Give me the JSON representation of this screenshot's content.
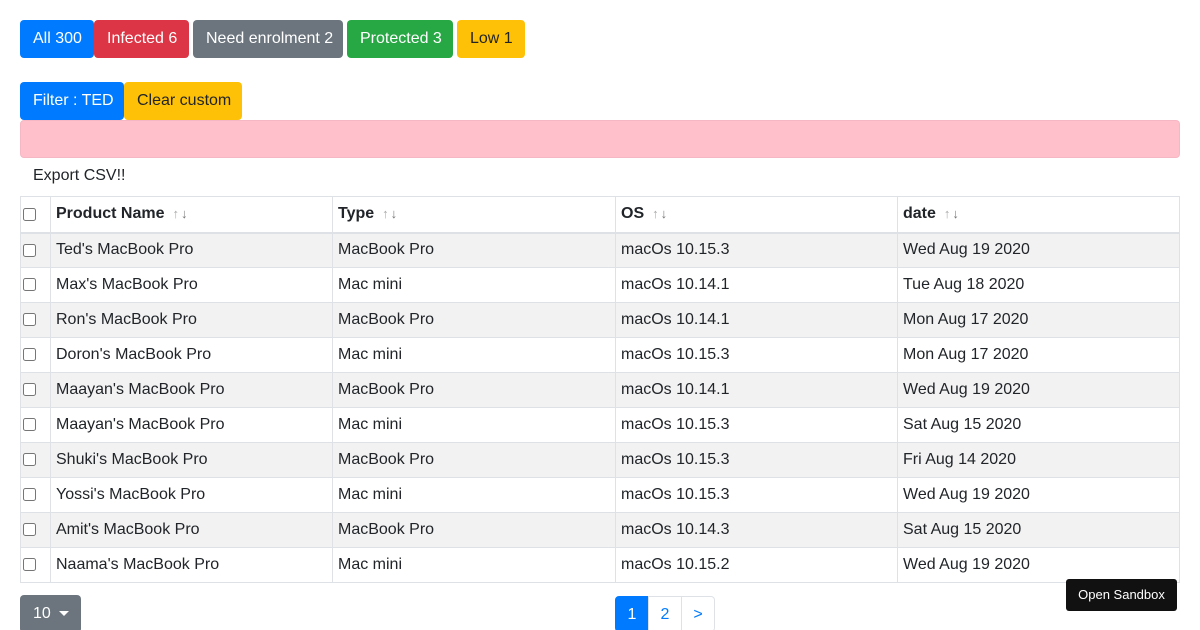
{
  "status_filters": {
    "all": "All 300",
    "infected": "Infected 6",
    "need_enrolment": "Need enrolment 2",
    "protected": "Protected 3",
    "low": "Low 1"
  },
  "filter_bar": {
    "filter_label": "Filter : TED",
    "clear_label": "Clear custom"
  },
  "export_label": "Export CSV!!",
  "table": {
    "headers": {
      "product_name": "Product Name",
      "type": "Type",
      "os": "OS",
      "date": "date"
    },
    "rows": [
      {
        "product_name": "Ted's MacBook Pro",
        "type": "MacBook Pro",
        "os": "macOs 10.15.3",
        "date": "Wed Aug 19 2020"
      },
      {
        "product_name": "Max's MacBook Pro",
        "type": "Mac mini",
        "os": "macOs 10.14.1",
        "date": "Tue Aug 18 2020"
      },
      {
        "product_name": "Ron's MacBook Pro",
        "type": "MacBook Pro",
        "os": "macOs 10.14.1",
        "date": "Mon Aug 17 2020"
      },
      {
        "product_name": "Doron's MacBook Pro",
        "type": "Mac mini",
        "os": "macOs 10.15.3",
        "date": "Mon Aug 17 2020"
      },
      {
        "product_name": "Maayan's MacBook Pro",
        "type": "MacBook Pro",
        "os": "macOs 10.14.1",
        "date": "Wed Aug 19 2020"
      },
      {
        "product_name": "Maayan's MacBook Pro",
        "type": "Mac mini",
        "os": "macOs 10.15.3",
        "date": "Sat Aug 15 2020"
      },
      {
        "product_name": "Shuki's MacBook Pro",
        "type": "MacBook Pro",
        "os": "macOs 10.15.3",
        "date": "Fri Aug 14 2020"
      },
      {
        "product_name": "Yossi's MacBook Pro",
        "type": "Mac mini",
        "os": "macOs 10.15.3",
        "date": "Wed Aug 19 2020"
      },
      {
        "product_name": "Amit's MacBook Pro",
        "type": "MacBook Pro",
        "os": "macOs 10.14.3",
        "date": "Sat Aug 15 2020"
      },
      {
        "product_name": "Naama's MacBook Pro",
        "type": "Mac mini",
        "os": "macOs 10.15.2",
        "date": "Wed Aug 19 2020"
      }
    ]
  },
  "sort_glyphs": {
    "up": "↑",
    "down": "↓"
  },
  "page_size": "10",
  "pagination": {
    "pages": [
      "1",
      "2"
    ],
    "next": ">",
    "active": "1"
  },
  "sandbox_label": "Open Sandbox",
  "colors": {
    "primary": "#007bff",
    "danger": "#dc3545",
    "secondary": "#6c757d",
    "success": "#28a745",
    "warning": "#ffc107",
    "alert_bg": "#ffc0cb"
  }
}
